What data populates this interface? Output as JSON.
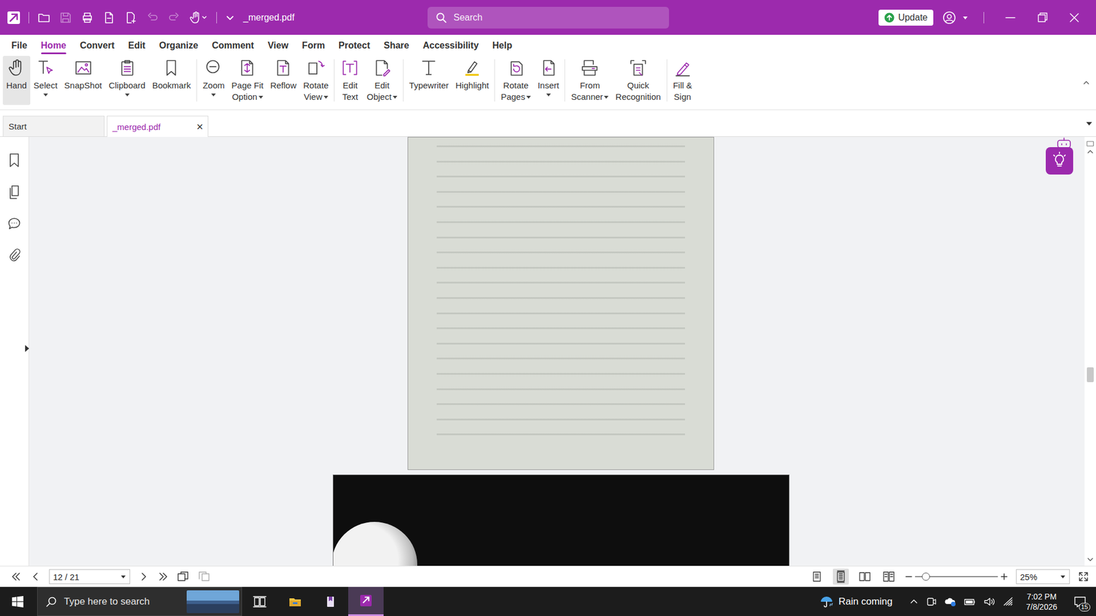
{
  "window": {
    "title": "_merged.pdf"
  },
  "quick_access": {
    "save_disabled": true,
    "undo_disabled": true,
    "redo_disabled": true
  },
  "search": {
    "placeholder": "Search"
  },
  "update_button": "Update",
  "menu": [
    {
      "label": "File",
      "selected": false
    },
    {
      "label": "Home",
      "selected": true
    },
    {
      "label": "Convert",
      "selected": false
    },
    {
      "label": "Edit",
      "selected": false
    },
    {
      "label": "Organize",
      "selected": false
    },
    {
      "label": "Comment",
      "selected": false
    },
    {
      "label": "View",
      "selected": false
    },
    {
      "label": "Form",
      "selected": false
    },
    {
      "label": "Protect",
      "selected": false
    },
    {
      "label": "Share",
      "selected": false
    },
    {
      "label": "Accessibility",
      "selected": false
    },
    {
      "label": "Help",
      "selected": false
    }
  ],
  "ribbon": [
    {
      "lines": [
        "Hand"
      ],
      "arrow": "none",
      "selected": true
    },
    {
      "lines": [
        "Select"
      ],
      "arrow": "below",
      "selected": false
    },
    {
      "lines": [
        "SnapShot"
      ],
      "arrow": "none",
      "selected": false
    },
    {
      "lines": [
        "Clipboard"
      ],
      "arrow": "below",
      "selected": false
    },
    {
      "lines": [
        "Bookmark"
      ],
      "arrow": "none",
      "selected": false
    },
    {
      "lines": [
        "Zoom"
      ],
      "arrow": "below",
      "selected": false
    },
    {
      "lines": [
        "Page Fit",
        "Option"
      ],
      "arrow": "inline",
      "selected": false
    },
    {
      "lines": [
        "Reflow"
      ],
      "arrow": "none",
      "selected": false
    },
    {
      "lines": [
        "Rotate",
        "View"
      ],
      "arrow": "inline",
      "selected": false
    },
    {
      "lines": [
        "Edit",
        "Text"
      ],
      "arrow": "none",
      "selected": false
    },
    {
      "lines": [
        "Edit",
        "Object"
      ],
      "arrow": "inline",
      "selected": false
    },
    {
      "lines": [
        "Typewriter"
      ],
      "arrow": "none",
      "selected": false
    },
    {
      "lines": [
        "Highlight"
      ],
      "arrow": "none",
      "selected": false
    },
    {
      "lines": [
        "Rotate",
        "Pages"
      ],
      "arrow": "inline",
      "selected": false
    },
    {
      "lines": [
        "Insert"
      ],
      "arrow": "below",
      "selected": false
    },
    {
      "lines": [
        "From",
        "Scanner"
      ],
      "arrow": "inline",
      "selected": false
    },
    {
      "lines": [
        "Quick",
        "Recognition"
      ],
      "arrow": "none",
      "selected": false
    },
    {
      "lines": [
        "Fill &",
        "Sign"
      ],
      "arrow": "none",
      "selected": false
    }
  ],
  "doc_tabs": [
    {
      "label": "Start",
      "selected": false,
      "closable": false
    },
    {
      "label": "_merged.pdf",
      "selected": true,
      "closable": true
    }
  ],
  "tab_close": "×",
  "vertical_scroll": {
    "level": 0.55
  },
  "page_nav": {
    "page": "12 / 21"
  },
  "view_modes": [
    {
      "selected": false
    },
    {
      "selected": true
    },
    {
      "selected": false
    },
    {
      "selected": false
    }
  ],
  "zoom": {
    "value": "25%",
    "level": 0.13
  },
  "taskbar": {
    "search_placeholder": "Type here to search",
    "apps": [
      {
        "active": false
      },
      {
        "active": false
      },
      {
        "active": false
      },
      {
        "active": true
      }
    ],
    "weather": "Rain coming",
    "time": "7:02 PM",
    "date": "7/8/2026",
    "notifications": "15"
  }
}
